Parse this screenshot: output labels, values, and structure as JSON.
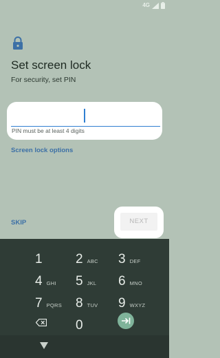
{
  "status_bar": {
    "network": "4G"
  },
  "header": {
    "title": "Set screen lock",
    "subtitle": "For security, set PIN"
  },
  "pin_field": {
    "value": "",
    "hint": "PIN must be at least 4 digits"
  },
  "links": {
    "screen_lock_options": "Screen lock options"
  },
  "actions": {
    "skip": "SKIP",
    "next": "NEXT"
  },
  "keypad": {
    "keys": [
      {
        "digit": "1",
        "letters": ""
      },
      {
        "digit": "2",
        "letters": "ABC"
      },
      {
        "digit": "3",
        "letters": "DEF"
      },
      {
        "digit": "4",
        "letters": "GHI"
      },
      {
        "digit": "5",
        "letters": "JKL"
      },
      {
        "digit": "6",
        "letters": "MNO"
      },
      {
        "digit": "7",
        "letters": "PQRS"
      },
      {
        "digit": "8",
        "letters": "TUV"
      },
      {
        "digit": "9",
        "letters": "WXYZ"
      },
      {
        "digit": "0",
        "letters": ""
      }
    ],
    "enter_color": "#7fb39a"
  },
  "icons": [
    "signal-icon",
    "battery-icon",
    "lock-icon",
    "backspace-icon",
    "enter-icon",
    "back-icon"
  ],
  "colors": {
    "accent": "#2f7fd1",
    "link": "#3d70a6",
    "background": "#b3c2b6",
    "keypad": "#2f3c36"
  }
}
